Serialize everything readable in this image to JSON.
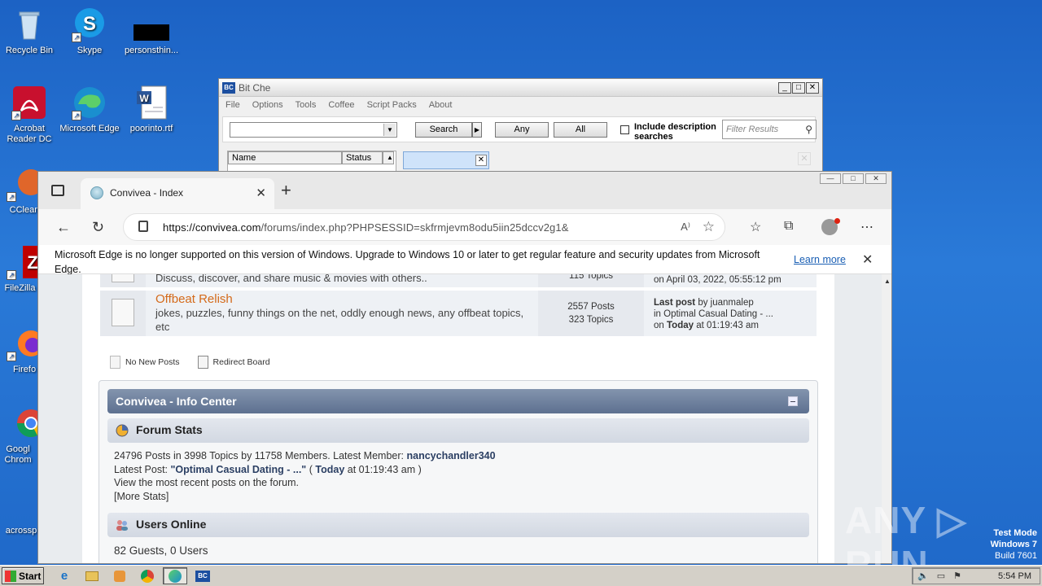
{
  "desktop": {
    "icons": [
      {
        "label": "Recycle Bin",
        "icon": "recycle-bin-icon"
      },
      {
        "label": "Skype",
        "icon": "skype-icon"
      },
      {
        "label": "personsthin...",
        "icon": "file-icon"
      },
      {
        "label": "Acrobat Reader DC",
        "icon": "acrobat-icon"
      },
      {
        "label": "Microsoft Edge",
        "icon": "edge-icon"
      },
      {
        "label": "poorinto.rtf",
        "icon": "word-doc-icon"
      },
      {
        "label": "CClean",
        "icon": "ccleaner-icon"
      },
      {
        "label": "FileZilla C",
        "icon": "filezilla-icon"
      },
      {
        "label": "Firefo",
        "icon": "firefox-icon"
      },
      {
        "label": "Googl Chrom",
        "icon": "chrome-icon"
      },
      {
        "label": "acrossp",
        "icon": "file-icon"
      }
    ]
  },
  "bitche": {
    "title": "Bit Che",
    "logo": "BC",
    "menu": [
      "File",
      "Options",
      "Tools",
      "Coffee",
      "Script Packs",
      "About"
    ],
    "search_label": "Search",
    "any_label": "Any",
    "all_label": "All",
    "include_desc_label": "Include description searches",
    "filter_placeholder": "Filter Results",
    "col_name": "Name",
    "col_status": "Status"
  },
  "edge": {
    "tab_title": "Convivea - Index",
    "url_host": "https://convivea.com",
    "url_path": "/forums/index.php?PHPSESSID=skfrmjevm8odu5iin25dccv2g1&",
    "notice": "Microsoft Edge is no longer supported on this version of Windows. Upgrade to Windows 10 or later to get regular feature and security updates from Microsoft Edge.",
    "learn_more": "Learn more"
  },
  "forum": {
    "row1": {
      "desc": "Discuss, discover, and share music & movies with others..",
      "topics": "115 Topics",
      "last_on": "on April 03, 2022, 05:55:12 pm"
    },
    "row2": {
      "name": "Offbeat Relish",
      "desc": "jokes, puzzles, funny things on the net, oddly enough news, any offbeat topics, etc",
      "posts": "2557 Posts",
      "topics": "323 Topics",
      "last_label": "Last post",
      "last_by": "by juanmalep",
      "last_in": "in Optimal Casual Dating - ...",
      "last_on_prefix": "on",
      "last_on_bold": "Today",
      "last_on_time": "at 01:19:43 am"
    },
    "legend": {
      "no_new": "No New Posts",
      "redirect": "Redirect Board"
    },
    "info_center": {
      "title": "Convivea - Info Center",
      "forum_stats_title": "Forum Stats",
      "stats_line1": "24796 Posts in 3998 Topics by 11758 Members. Latest Member:",
      "latest_member": "nancychandler340",
      "latest_post_label": "Latest Post:",
      "latest_post": "\"Optimal Casual Dating - ...\"",
      "latest_post_when_open": "(",
      "latest_post_today": "Today",
      "latest_post_time": "at 01:19:43 am )",
      "stats_line3": "View the most recent posts on the forum.",
      "more_stats": "[More Stats]",
      "users_online_title": "Users Online",
      "users_online": "82 Guests, 0 Users"
    }
  },
  "taskbar": {
    "start": "Start",
    "clock": "5:54 PM"
  },
  "overlay": {
    "test_mode": "Test Mode",
    "windows": "Windows 7",
    "build": "Build 7601",
    "watermark": "ANY ▷ RUN"
  }
}
